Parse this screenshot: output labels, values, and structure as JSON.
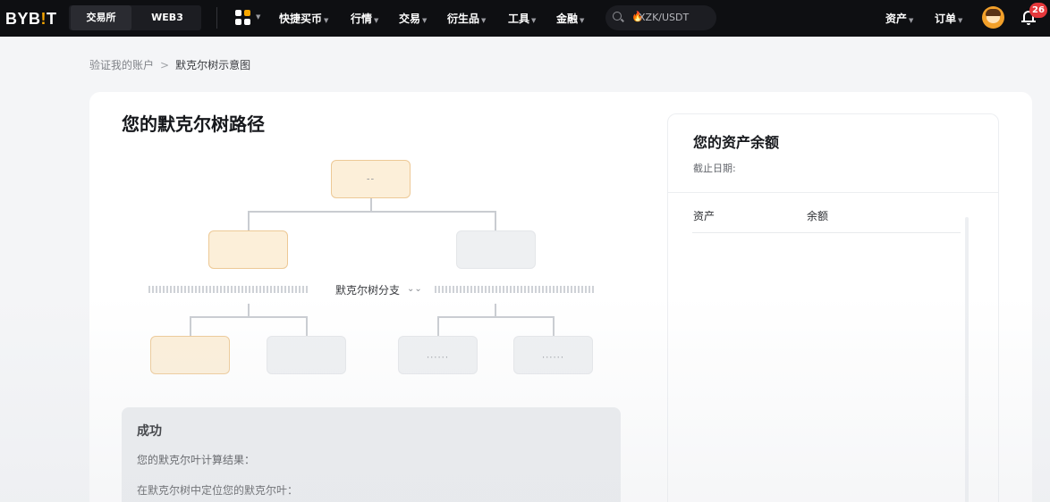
{
  "nav": {
    "logo_pre": "BYB",
    "logo_bang": "!",
    "logo_post": "T",
    "tabs": [
      "交易所",
      "WEB3"
    ],
    "menu": [
      "快捷买币",
      "行情",
      "交易",
      "衍生品",
      "工具",
      "金融"
    ],
    "search_placeholder": "XZK/USDT",
    "assets": "资产",
    "orders": "订单",
    "notification_count": "26"
  },
  "breadcrumb": {
    "parent": "验证我的账户",
    "separator": ">",
    "current": "默克尔树示意图"
  },
  "main": {
    "title": "您的默克尔树路径",
    "root_dots": "--",
    "leaf_dots_1": "......",
    "leaf_dots_2": "......",
    "branch_label": "默克尔树分支",
    "branch_caret": "⌄⌄"
  },
  "result": {
    "title": "成功",
    "line1": "您的默克尔叶计算结果：",
    "line2": "在默克尔树中定位您的默克尔叶："
  },
  "balance_panel": {
    "title": "您的资产余额",
    "date_label": "截止日期:",
    "col_asset": "资产",
    "col_balance": "余额"
  },
  "colors": {
    "topbar_bg": "#0e0f12",
    "accent": "#f7a600",
    "highlight_node": "#fcefd9",
    "badge": "#e5383b"
  },
  "icons": [
    "apps-icon",
    "search-icon",
    "fire-icon",
    "avatar",
    "bell-icon"
  ]
}
